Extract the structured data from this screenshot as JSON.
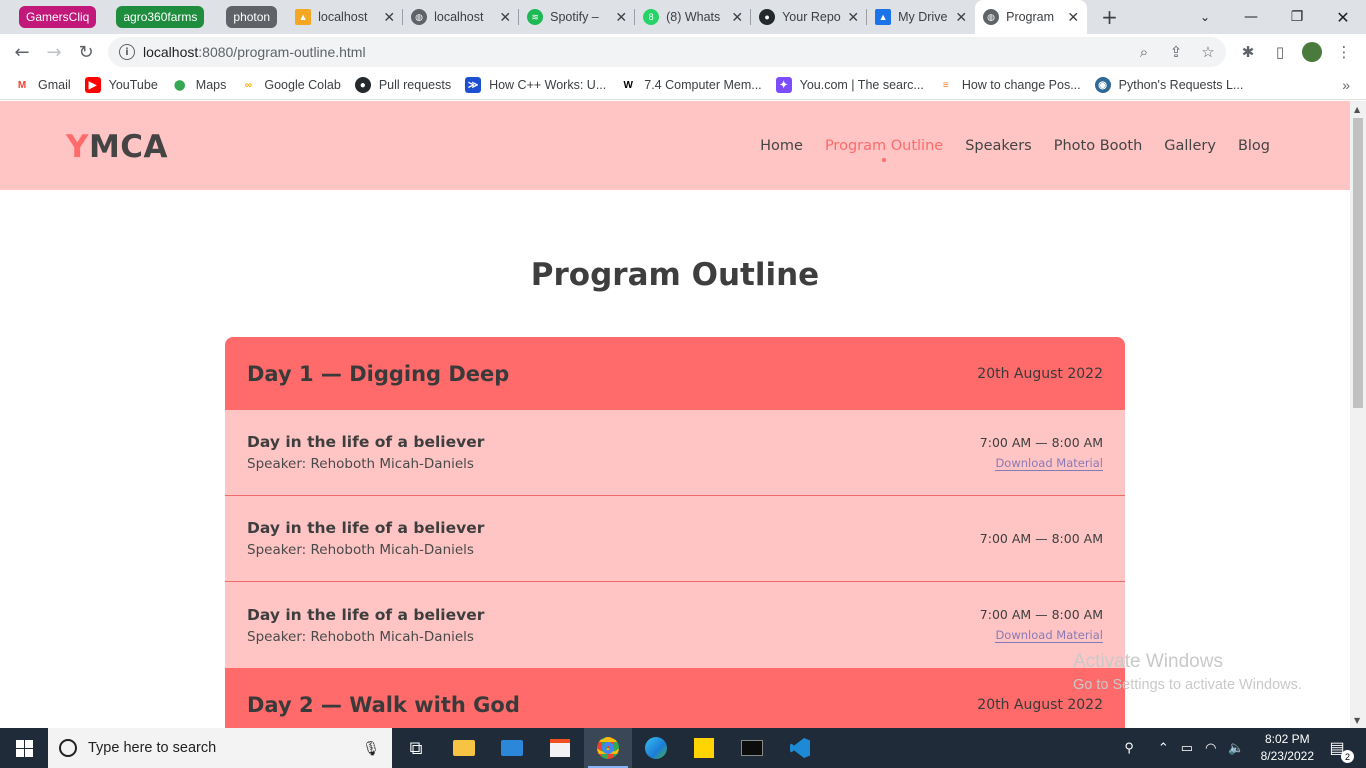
{
  "browser": {
    "tab_groups": [
      {
        "label": "GamersCliq",
        "color": "#c2187a"
      },
      {
        "label": "agro360farms",
        "color": "#1e8e3e"
      },
      {
        "label": "photon",
        "color": "#5f6368"
      }
    ],
    "tabs": [
      {
        "title": "localhost",
        "icon": "phpmyadmin-icon",
        "color": "#f5a623"
      },
      {
        "title": "localhost",
        "icon": "globe-icon",
        "color": "#5f6368"
      },
      {
        "title": "Spotify – ",
        "icon": "spotify-icon",
        "color": "#1db954"
      },
      {
        "title": "(8) Whats",
        "icon": "whatsapp-icon",
        "color": "#25d366"
      },
      {
        "title": "Your Repo",
        "icon": "github-icon",
        "color": "#24292e"
      },
      {
        "title": "My Drive",
        "icon": "google-drive-icon",
        "color": "#1a73e8"
      },
      {
        "title": "Program",
        "icon": "globe-icon",
        "color": "#5f6368",
        "active": true
      }
    ],
    "url_host": "localhost",
    "url_rest": ":8080/program-outline.html",
    "bookmarks": [
      {
        "label": "Gmail",
        "icon": "gmail-icon",
        "color": "#ea4335",
        "glyph": "M"
      },
      {
        "label": "YouTube",
        "icon": "youtube-icon",
        "color": "#ff0000",
        "glyph": "▶"
      },
      {
        "label": "Maps",
        "icon": "maps-icon",
        "color": "#34a853",
        "glyph": "⬤"
      },
      {
        "label": "Google Colab",
        "icon": "colab-icon",
        "color": "#f9ab00",
        "glyph": "∞"
      },
      {
        "label": "Pull requests",
        "icon": "github-icon",
        "color": "#24292e",
        "glyph": "●"
      },
      {
        "label": "How C++ Works: U...",
        "icon": "bookmark-icon",
        "color": "#1f4fd1",
        "glyph": "≫"
      },
      {
        "label": "7.4 Computer Mem...",
        "icon": "w-icon",
        "color": "#000000",
        "glyph": "W"
      },
      {
        "label": "You.com | The searc...",
        "icon": "youcom-icon",
        "color": "#7c4dff",
        "glyph": "✦"
      },
      {
        "label": "How to change Pos...",
        "icon": "stackoverflow-icon",
        "color": "#f48024",
        "glyph": "≡"
      },
      {
        "label": "Python's Requests L...",
        "icon": "python-icon",
        "color": "#306998",
        "glyph": "◉"
      }
    ]
  },
  "site": {
    "logo_initial": "Y",
    "logo_rest": "MCA",
    "nav": [
      "Home",
      "Program Outline",
      "Speakers",
      "Photo Booth",
      "Gallery",
      "Blog"
    ],
    "active_nav": "Program Outline",
    "page_title": "Program Outline"
  },
  "program": {
    "days": [
      {
        "title": "Day 1 — Digging Deep",
        "date": "20th August 2022",
        "sessions": [
          {
            "title": "Day in the life of a believer",
            "speaker": "Speaker: Rehoboth Micah-Daniels",
            "time": "7:00 AM — 8:00 AM",
            "download": "Download Material"
          },
          {
            "title": "Day in the life of a believer",
            "speaker": "Speaker: Rehoboth Micah-Daniels",
            "time": "7:00 AM — 8:00 AM",
            "download": ""
          },
          {
            "title": "Day in the life of a believer",
            "speaker": "Speaker: Rehoboth Micah-Daniels",
            "time": "7:00 AM — 8:00 AM",
            "download": "Download Material"
          }
        ]
      },
      {
        "title": "Day 2 — Walk with God",
        "date": "20th August 2022",
        "sessions": []
      }
    ]
  },
  "watermark": {
    "line1": "Activate Windows",
    "line2": "Go to Settings to activate Windows."
  },
  "taskbar": {
    "search_placeholder": "Type here to search",
    "time": "8:02 PM",
    "date": "8/23/2022",
    "notification_count": "2"
  },
  "colors": {
    "accent": "#ff6b6b",
    "header_bg": "#ffc5c5",
    "session_bg": "#ffc5c5",
    "text_dark": "#3e3e3e"
  }
}
